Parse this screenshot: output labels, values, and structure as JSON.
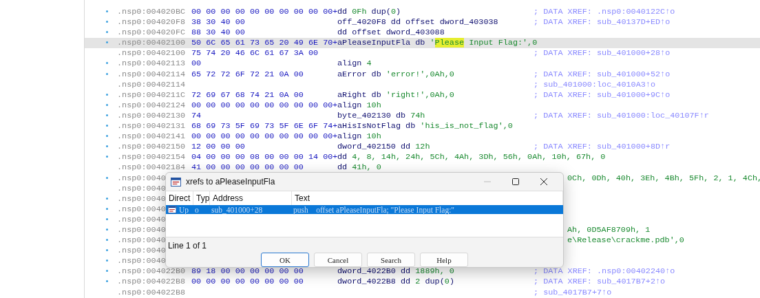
{
  "listing": {
    "rows": [
      {
        "marked": true,
        "selected": false,
        "address": ".nsp0:004020BC",
        "bytes": "00 00 00 00 00 00 00 00 00 00+",
        "code": [
          {
            "kind": "ident",
            "text": "dd "
          },
          {
            "kind": "literal",
            "text": "0Fh"
          },
          {
            "kind": "ident",
            "text": " dup("
          },
          {
            "kind": "literal",
            "text": "0"
          },
          {
            "kind": "ident",
            "text": ")"
          }
        ],
        "comment": "; DATA XREF: .nsp0:0040122C↑o"
      },
      {
        "marked": true,
        "selected": false,
        "address": ".nsp0:004020F8",
        "bytes": "38 30 40 00",
        "code": [
          {
            "kind": "ident",
            "text": "off_4020F8 dd offset dword_403038"
          }
        ],
        "comment": "; DATA XREF: sub_40137D+ED↑o"
      },
      {
        "marked": true,
        "selected": false,
        "address": ".nsp0:004020FC",
        "bytes": "88 30 40 00",
        "code": [
          {
            "kind": "ident",
            "text": "dd offset dword_403088"
          }
        ]
      },
      {
        "marked": true,
        "selected": true,
        "address": ".nsp0:00402100",
        "bytes": "50 6C 65 61 73 65 20 49 6E 70+",
        "code": [
          {
            "kind": "ident",
            "text": "aPleaseInputFla db "
          },
          {
            "kind": "literal",
            "text": "'"
          },
          {
            "kind": "match",
            "text": "Please"
          },
          {
            "kind": "literal",
            "text": " Input Flag:',0"
          }
        ]
      },
      {
        "marked": false,
        "selected": false,
        "address": ".nsp0:00402100",
        "bytes": "75 74 20 46 6C 61 67 3A 00",
        "comment": "; DATA XREF: sub_401000+28↑o"
      },
      {
        "marked": true,
        "selected": false,
        "address": ".nsp0:00402113",
        "bytes": "00",
        "code": [
          {
            "kind": "ident",
            "text": "align "
          },
          {
            "kind": "literal",
            "text": "4"
          }
        ]
      },
      {
        "marked": true,
        "selected": false,
        "address": ".nsp0:00402114",
        "bytes": "65 72 72 6F 72 21 0A 00",
        "code": [
          {
            "kind": "ident",
            "text": "aError db "
          },
          {
            "kind": "literal",
            "text": "'error!',0Ah,0"
          }
        ],
        "comment": "; DATA XREF: sub_401000+52↑o"
      },
      {
        "marked": false,
        "selected": false,
        "address": ".nsp0:00402114",
        "comment": "; sub_401000:loc_4010A3↑o"
      },
      {
        "marked": true,
        "selected": false,
        "address": ".nsp0:0040211C",
        "bytes": "72 69 67 68 74 21 0A 00",
        "code": [
          {
            "kind": "ident",
            "text": "aRight db "
          },
          {
            "kind": "literal",
            "text": "'right!',0Ah,0"
          }
        ],
        "comment": "; DATA XREF: sub_401000+9C↑o"
      },
      {
        "marked": true,
        "selected": false,
        "address": ".nsp0:00402124",
        "bytes": "00 00 00 00 00 00 00 00 00 00+",
        "code": [
          {
            "kind": "ident",
            "text": "align "
          },
          {
            "kind": "literal",
            "text": "10h"
          }
        ]
      },
      {
        "marked": true,
        "selected": false,
        "address": ".nsp0:00402130",
        "bytes": "74",
        "code": [
          {
            "kind": "ident",
            "text": "byte_402130 db "
          },
          {
            "kind": "literal",
            "text": "74h"
          }
        ],
        "comment": "; DATA XREF: sub_401000:loc_40107F↑r"
      },
      {
        "marked": true,
        "selected": false,
        "address": ".nsp0:00402131",
        "bytes": "68 69 73 5F 69 73 5F 6E 6F 74+",
        "code": [
          {
            "kind": "ident",
            "text": "aHisIsNotFlag db "
          },
          {
            "kind": "literal",
            "text": "'his_is_not_flag',0"
          }
        ]
      },
      {
        "marked": true,
        "selected": false,
        "address": ".nsp0:00402141",
        "bytes": "00 00 00 00 00 00 00 00 00 00+",
        "code": [
          {
            "kind": "ident",
            "text": "align "
          },
          {
            "kind": "literal",
            "text": "10h"
          }
        ]
      },
      {
        "marked": true,
        "selected": false,
        "address": ".nsp0:00402150",
        "bytes": "12 00 00 00",
        "code": [
          {
            "kind": "ident",
            "text": "dword_402150 dd "
          },
          {
            "kind": "literal",
            "text": "12h"
          }
        ],
        "comment": "; DATA XREF: sub_401000+8D↑r"
      },
      {
        "marked": true,
        "selected": false,
        "address": ".nsp0:00402154",
        "bytes": "04 00 00 00 08 00 00 00 14 00+",
        "code": [
          {
            "kind": "ident",
            "text": "dd "
          },
          {
            "kind": "literal",
            "text": "4, 8, 14h, 24h, 5Ch, 4Ah, 3Dh, 56h, 0Ah, 10h, 67h, 0"
          }
        ]
      },
      {
        "marked": false,
        "selected": false,
        "address": ".nsp0:00402184",
        "bytes": "41 00 00 00 00 00 00 00",
        "code": [
          {
            "kind": "ident",
            "text": "dd "
          },
          {
            "kind": "literal",
            "text": "41h, 0"
          }
        ]
      },
      {
        "marked": true,
        "selected": false,
        "address": ".nsp0:0040",
        "tail": [
          {
            "kind": "literal",
            "text": "0Ch, 0Dh, 40h, 3Eh, 4Bh, 5Fh, 2, 1, 4Ch,"
          }
        ]
      },
      {
        "marked": false,
        "selected": false,
        "address": ".nsp0:0040"
      },
      {
        "marked": true,
        "selected": false,
        "address": ".nsp0:0040"
      },
      {
        "marked": true,
        "selected": false,
        "address": ".nsp0:0040"
      },
      {
        "marked": true,
        "selected": false,
        "address": ".nsp0:0040"
      },
      {
        "marked": true,
        "selected": false,
        "address": ".nsp0:0040",
        "tail": [
          {
            "kind": "literal",
            "text": "Ah, 0D5AF8709h, 1"
          }
        ]
      },
      {
        "marked": true,
        "selected": false,
        "address": ".nsp0:0040",
        "tail": [
          {
            "kind": "literal",
            "text": "e\\Release\\crackme.pdb',0"
          }
        ]
      },
      {
        "marked": true,
        "selected": false,
        "address": ".nsp0:0040"
      },
      {
        "marked": true,
        "selected": false,
        "address": ".nsp0:0040"
      },
      {
        "marked": true,
        "selected": false,
        "address": ".nsp0:004022B0",
        "bytes": "89 18 00 00 00 00 00 00",
        "code": [
          {
            "kind": "ident",
            "text": "dword_4022B0 dd "
          },
          {
            "kind": "literal",
            "text": "1889h, 0"
          }
        ],
        "comment": "; DATA XREF: .nsp0:00402240↑o"
      },
      {
        "marked": true,
        "selected": false,
        "address": ".nsp0:004022B8",
        "bytes": "00 00 00 00 00 00 00 00",
        "code": [
          {
            "kind": "ident",
            "text": "dword_4022B8 dd "
          },
          {
            "kind": "literal",
            "text": "2"
          },
          {
            "kind": "ident",
            "text": " dup("
          },
          {
            "kind": "literal",
            "text": "0"
          },
          {
            "kind": "ident",
            "text": ")"
          }
        ],
        "comment": "; DATA XREF: sub_4017B7+2↑o"
      },
      {
        "marked": false,
        "selected": false,
        "address": ".nsp0:004022B8",
        "comment": "; sub_4017B7+7↑o"
      }
    ]
  },
  "xrefs_dialog": {
    "title": "xrefs to aPleaseInputFla",
    "columns": [
      "Direct",
      "Typ",
      "Address",
      "Text"
    ],
    "rows": [
      {
        "selected": true,
        "direction": "Up",
        "type": "o",
        "address": "sub_401000+28",
        "text": "push    offset aPleaseInputFla; \"Please Input Flag:\""
      }
    ],
    "status": "Line 1 of 1",
    "buttons": [
      {
        "label": "OK",
        "default": true
      },
      {
        "label": "Cancel",
        "default": false
      },
      {
        "label": "Search",
        "default": false
      },
      {
        "label": "Help",
        "default": false
      }
    ]
  }
}
